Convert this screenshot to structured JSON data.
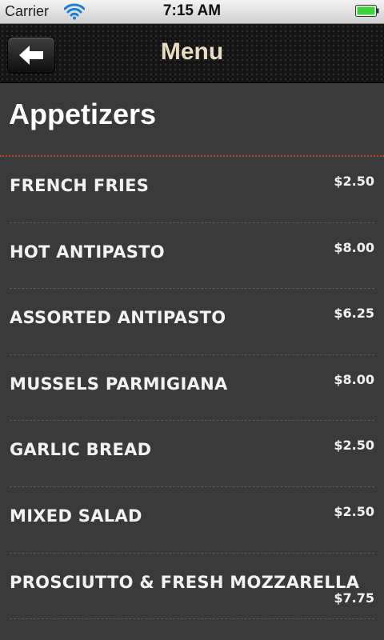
{
  "status_bar": {
    "carrier": "Carrier",
    "time": "7:15 AM",
    "wifi_icon": "wifi-icon",
    "battery_icon": "battery-full-icon",
    "battery_color": "#3fd23a"
  },
  "nav": {
    "title": "Menu",
    "back_icon": "back-arrow-icon"
  },
  "section": {
    "title": "Appetizers",
    "divider_color": "#c0451f"
  },
  "items": [
    {
      "name": "FRENCH FRIES",
      "price": "$2.50"
    },
    {
      "name": "HOT ANTIPASTO",
      "price": "$8.00"
    },
    {
      "name": "ASSORTED ANTIPASTO",
      "price": "$6.25"
    },
    {
      "name": "MUSSELS PARMIGIANA",
      "price": "$8.00"
    },
    {
      "name": "GARLIC BREAD",
      "price": "$2.50"
    },
    {
      "name": "MIXED SALAD",
      "price": "$2.50"
    },
    {
      "name": "PROSCIUTTO & FRESH MOZZARELLA",
      "price": "$7.75"
    }
  ]
}
